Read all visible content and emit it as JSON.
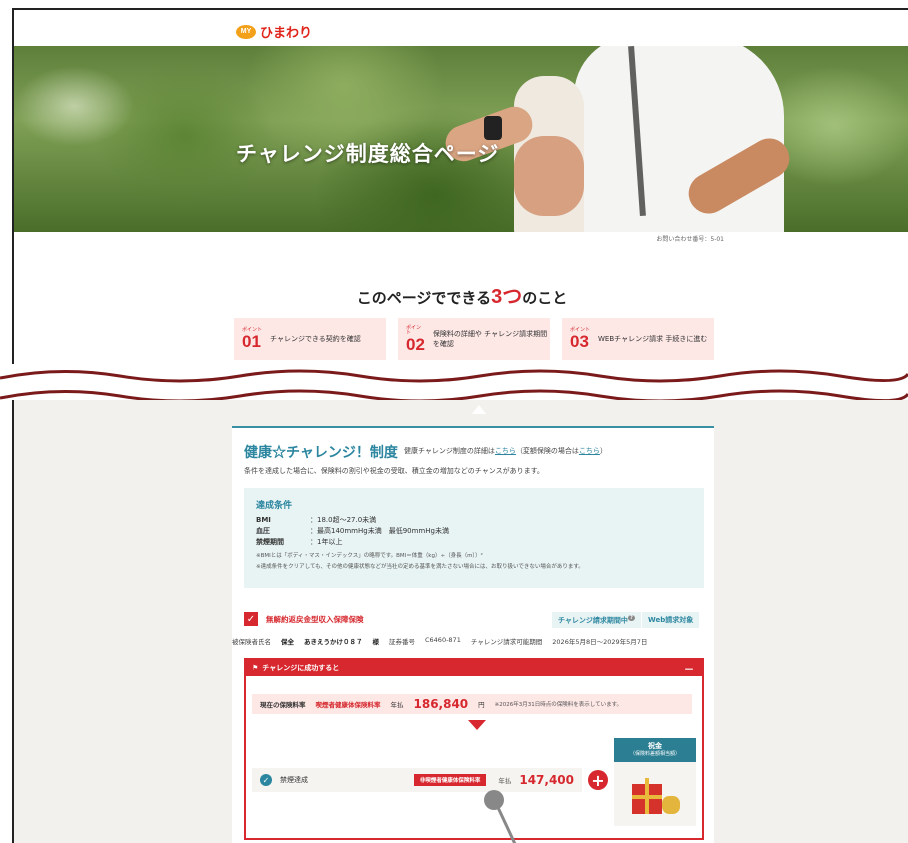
{
  "brand": {
    "badge": "MY",
    "name": "ひまわり"
  },
  "hero": {
    "title": "チャレンジ制度総合ページ"
  },
  "contact": "お問い合わせ番号：5-01",
  "intro": {
    "prefix": "このページでできる",
    "number": "3つ",
    "suffix": "のこと"
  },
  "points": [
    {
      "label": "ポイント",
      "no": "01",
      "text": "チャレンジできる契約を確認"
    },
    {
      "label": "ポイント",
      "no": "02",
      "text": "保険料の詳細や チャレンジ請求期間を確認"
    },
    {
      "label": "ポイント",
      "no": "03",
      "text": "WEBチャレンジ請求 手続きに進む"
    }
  ],
  "program": {
    "title": "健康☆チャレンジ！制度",
    "sub_prefix": "健康チャレンジ制度の詳細は",
    "link1": "こちら",
    "sub_mid": "（変額保険の場合は",
    "link2": "こちら",
    "sub_suffix": "）",
    "desc": "条件を達成した場合に、保険料の割引や祝金の受取、積立金の増加などのチャンスがあります。"
  },
  "conditions": {
    "heading": "達成条件",
    "rows": [
      {
        "k": "BMI",
        "v": "：18.0超～27.0未満"
      },
      {
        "k": "血圧",
        "v": "：最高140mmHg未満　最低90mmHg未満"
      },
      {
        "k": "禁煙期間",
        "v": "：1年以上"
      }
    ],
    "note1": "※BMIとは「ボディ・マス・インデックス」の略称です。BMI＝体重（kg）÷（身長（m））²",
    "note2": "※達成条件をクリアしても、その他の健康状態などが当社の定める基準を満たさない場合には、お取り扱いできない場合があります。"
  },
  "product": {
    "name": "無解約返戻金型収入保障保険",
    "status": "チャレンジ請求期間中",
    "web": "Web請求対象",
    "insured_label": "被保険者氏名",
    "insured_type": "保全",
    "insured_name": "あきえうかけ０８７",
    "honorific": "様",
    "policy_label": "証券番号",
    "policy_no": "C6460-871",
    "period_label": "チャレンジ請求可能期間",
    "period": "2026年5月8日～2029年5月7日"
  },
  "success": {
    "bar": "チャレンジに成功すると",
    "minus": "－",
    "current_label": "現在の保険料率",
    "current_rate": "喫煙者健康体保険料率",
    "annual": "年払",
    "current_amount": "186,840",
    "yen": "円",
    "current_note": "※2026年3月31日時点の保険料を表示しています。",
    "done_label": "禁煙達成",
    "new_rate": "非喫煙者健康体保険料率",
    "new_amount": "147,400",
    "gift_title": "祝金",
    "gift_sub": "（保険料差額相当額）"
  }
}
